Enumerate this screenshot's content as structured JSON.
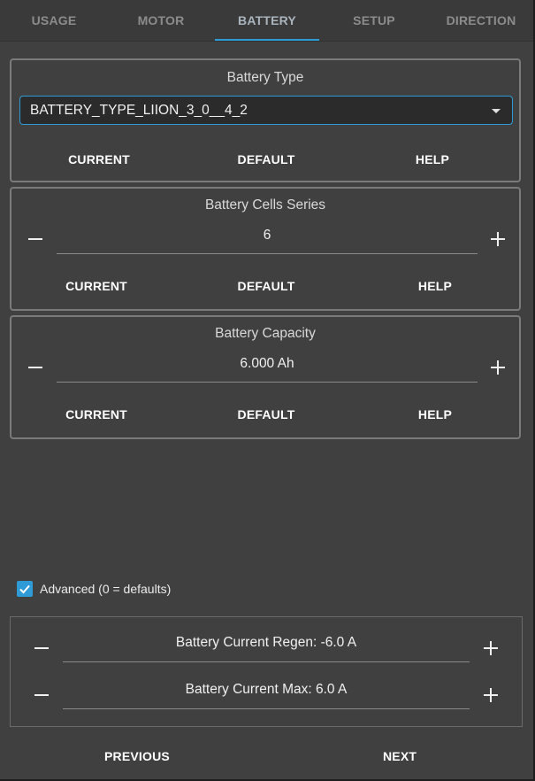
{
  "tabs": [
    {
      "label": "USAGE"
    },
    {
      "label": "MOTOR"
    },
    {
      "label": "BATTERY"
    },
    {
      "label": "SETUP"
    },
    {
      "label": "DIRECTION"
    }
  ],
  "active_tab": "BATTERY",
  "battery_type": {
    "title": "Battery Type",
    "selected": "BATTERY_TYPE_LIION_3_0__4_2",
    "buttons": {
      "current": "CURRENT",
      "default": "DEFAULT",
      "help": "HELP"
    }
  },
  "cells_series": {
    "title": "Battery Cells Series",
    "value": "6",
    "buttons": {
      "current": "CURRENT",
      "default": "DEFAULT",
      "help": "HELP"
    }
  },
  "capacity": {
    "title": "Battery Capacity",
    "value": "6.000 Ah",
    "buttons": {
      "current": "CURRENT",
      "default": "DEFAULT",
      "help": "HELP"
    }
  },
  "advanced": {
    "label": "Advanced (0 = defaults)",
    "checked": true,
    "regen": "Battery Current Regen: -6.0 A",
    "max": "Battery Current Max: 6.0 A"
  },
  "nav": {
    "previous": "PREVIOUS",
    "next": "NEXT"
  },
  "colors": {
    "accent": "#2f9bd6",
    "background": "#404040"
  }
}
